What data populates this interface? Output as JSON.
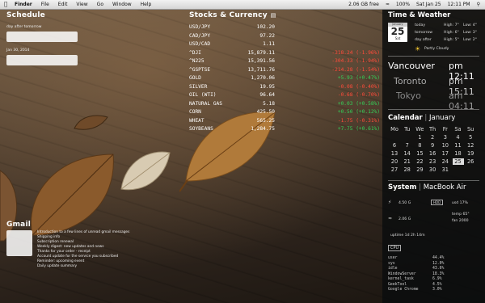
{
  "menubar": {
    "menus": [
      "Finder",
      "File",
      "Edit",
      "View",
      "Go",
      "Window",
      "Help"
    ],
    "status": [
      "2.06 GB free",
      "100%",
      "Sat Jan 25",
      "12:11 PM"
    ]
  },
  "schedule": {
    "title": "Schedule",
    "day_after_label": "day after tomorrow",
    "date_label": "Jan 30, 2014"
  },
  "stocks": {
    "title": "Stocks & Currency",
    "rows": [
      {
        "name": "USD/JPY",
        "price": "102.20",
        "change": "",
        "dir": "up"
      },
      {
        "name": "CAD/JPY",
        "price": "97.22",
        "change": "",
        "dir": "up"
      },
      {
        "name": "USD/CAD",
        "price": "1.11",
        "change": "",
        "dir": "up"
      },
      {
        "name": "^DJI",
        "price": "15,879.11",
        "change": "-318.24 (-1.96%)",
        "dir": "down"
      },
      {
        "name": "^N225",
        "price": "15,391.56",
        "change": "-304.33 (-1.94%)",
        "dir": "down"
      },
      {
        "name": "^GSPTSE",
        "price": "13,711.76",
        "change": "-214.28 (-1.54%)",
        "dir": "down"
      },
      {
        "name": "GOLD",
        "price": "1,270.06",
        "change": "+5.93 (+0.47%)",
        "dir": "up"
      },
      {
        "name": "SILVER",
        "price": "19.95",
        "change": "-0.08 (-0.40%)",
        "dir": "down"
      },
      {
        "name": "OIL (WTI)",
        "price": "96.64",
        "change": "-0.68 (-0.70%)",
        "dir": "down"
      },
      {
        "name": "NATURAL GAS",
        "price": "5.18",
        "change": "+0.03 (+0.58%)",
        "dir": "up"
      },
      {
        "name": "CORN",
        "price": "425.50",
        "change": "+0.50 (+0.12%)",
        "dir": "up"
      },
      {
        "name": "WHEAT",
        "price": "565.25",
        "change": "-1.75 (-0.31%)",
        "dir": "down"
      },
      {
        "name": "SOYBEANS",
        "price": "1,284.75",
        "change": "+7.75 (+0.61%)",
        "dir": "up"
      }
    ]
  },
  "weather": {
    "title": "Time & Weather",
    "month": "January",
    "day": "25",
    "weekday": "Sat",
    "today_label": "today",
    "condition": "Partly Cloudy",
    "forecast": [
      {
        "label": "today",
        "high": "High: 7°",
        "low": "Low: 4°"
      },
      {
        "label": "tomorrow",
        "high": "High: 6°",
        "low": "Low: 3°"
      },
      {
        "label": "day after",
        "high": "High: 5°",
        "low": "Low: 2°"
      }
    ]
  },
  "clocks": [
    {
      "city": "Vancouver",
      "ampm": "pm",
      "time": "12:11"
    },
    {
      "city": "Toronto",
      "ampm": "pm",
      "time": "15:11"
    },
    {
      "city": "Tokyo",
      "ampm": "am",
      "time": "04:11"
    }
  ],
  "calendar": {
    "title": "Calendar",
    "month": "January",
    "weekdays": [
      "Mo",
      "Tu",
      "We",
      "Th",
      "Fr",
      "Sa",
      "Su"
    ],
    "today": "25"
  },
  "system": {
    "title": "System",
    "machine": "MacBook Air",
    "hdd_label": "HDD",
    "cpu_label": "CPU",
    "stats": [
      "4.50 G",
      "2.06 G",
      "usd 17%",
      "temp 65°",
      "fan 2000",
      "Wi-Fi"
    ],
    "uptime": "uptime 1d 2h 14m",
    "processes": [
      {
        "name": "user",
        "value": "44.4%"
      },
      {
        "name": "sys",
        "value": "12.0%"
      },
      {
        "name": "idle",
        "value": "43.6%"
      },
      {
        "name": "WindowServer",
        "value": "18.3%"
      },
      {
        "name": "kernel_task",
        "value": "6.9%"
      },
      {
        "name": "GeekTool",
        "value": "4.5%"
      },
      {
        "name": "Google Chrome",
        "value": "3.0%"
      }
    ]
  },
  "gmail": {
    "title": "Gmail",
    "lines": [
      "Introduction to a few lines of unread gmail messages",
      "Shipping info",
      "Subscription renewal",
      "Weekly digest: new updates and news",
      "Thanks for your order - receipt",
      "Account update for the service you subscribed",
      "Reminder: upcoming event",
      "Daily update summary"
    ]
  }
}
